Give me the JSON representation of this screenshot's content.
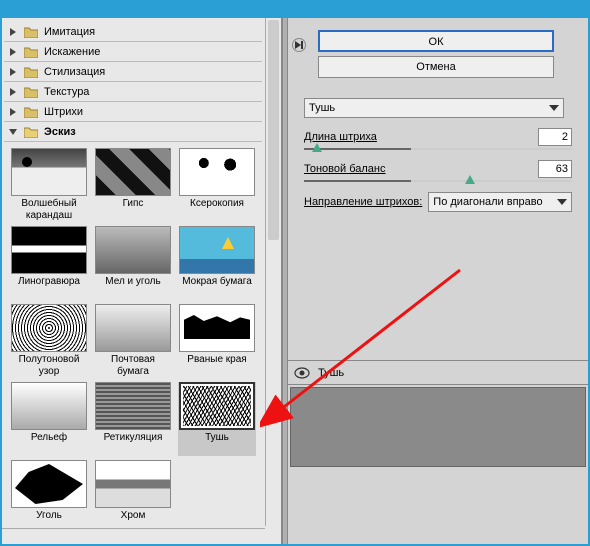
{
  "sidebar": {
    "folders": [
      {
        "label": "Имитация"
      },
      {
        "label": "Искажение"
      },
      {
        "label": "Стилизация"
      },
      {
        "label": "Текстура"
      },
      {
        "label": "Штрихи"
      },
      {
        "label": "Эскиз"
      }
    ],
    "thumbs": [
      {
        "label": "Волшебный карандаш"
      },
      {
        "label": "Гипс"
      },
      {
        "label": "Ксерокопия"
      },
      {
        "label": "Линогравюра"
      },
      {
        "label": "Мел и уголь"
      },
      {
        "label": "Мокрая бумага"
      },
      {
        "label": "Полутоновой узор"
      },
      {
        "label": "Почтовая бумага"
      },
      {
        "label": "Рваные края"
      },
      {
        "label": "Рельеф"
      },
      {
        "label": "Ретикуляция"
      },
      {
        "label": "Тушь"
      },
      {
        "label": "Уголь"
      },
      {
        "label": "Хром"
      }
    ],
    "selected_index": 11
  },
  "controls": {
    "ok_label": "ОК",
    "cancel_label": "Отмена",
    "filter_selected": "Тушь",
    "stroke_length_label": "Длина штриха",
    "stroke_length_value": "2",
    "tone_balance_label": "Тоновой баланс",
    "tone_balance_value": "63",
    "direction_label": "Направление штрихов:",
    "direction_value": "По диагонали вправо"
  },
  "layers": {
    "active_label": "Тушь"
  }
}
